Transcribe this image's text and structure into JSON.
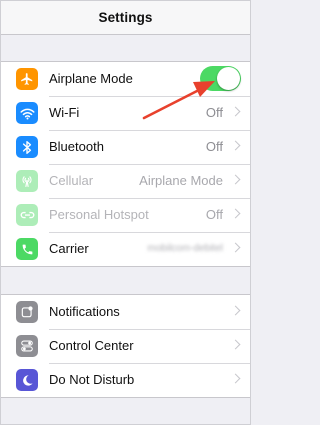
{
  "navbar": {
    "title": "Settings"
  },
  "colors": {
    "toggle_on": "#4cd964",
    "annotation_arrow": "#e8412d",
    "airplane": "#ff9500",
    "wifi": "#1a8cff",
    "bluetooth": "#1a8cff",
    "cellular": "#4cd964",
    "hotspot": "#4cd964",
    "carrier": "#4cd964",
    "notifications": "#8e8e93",
    "control_center": "#8e8e93",
    "do_not_disturb": "#5856d6"
  },
  "group1": {
    "airplane_mode": {
      "label": "Airplane Mode",
      "toggle_on": true,
      "icon": "airplane-icon"
    },
    "wifi": {
      "label": "Wi-Fi",
      "value": "Off",
      "icon": "wifi-icon"
    },
    "bluetooth": {
      "label": "Bluetooth",
      "value": "Off",
      "icon": "bluetooth-icon"
    },
    "cellular": {
      "label": "Cellular",
      "value": "Airplane Mode",
      "icon": "cellular-antenna-icon"
    },
    "personal_hotspot": {
      "label": "Personal Hotspot",
      "value": "Off",
      "icon": "hotspot-icon"
    },
    "carrier": {
      "label": "Carrier",
      "value": "mobilcom-debitel",
      "icon": "phone-icon"
    }
  },
  "group2": {
    "notifications": {
      "label": "Notifications",
      "icon": "notifications-icon"
    },
    "control_center": {
      "label": "Control Center",
      "icon": "control-center-icon"
    },
    "do_not_disturb": {
      "label": "Do Not Disturb",
      "icon": "moon-icon"
    }
  }
}
